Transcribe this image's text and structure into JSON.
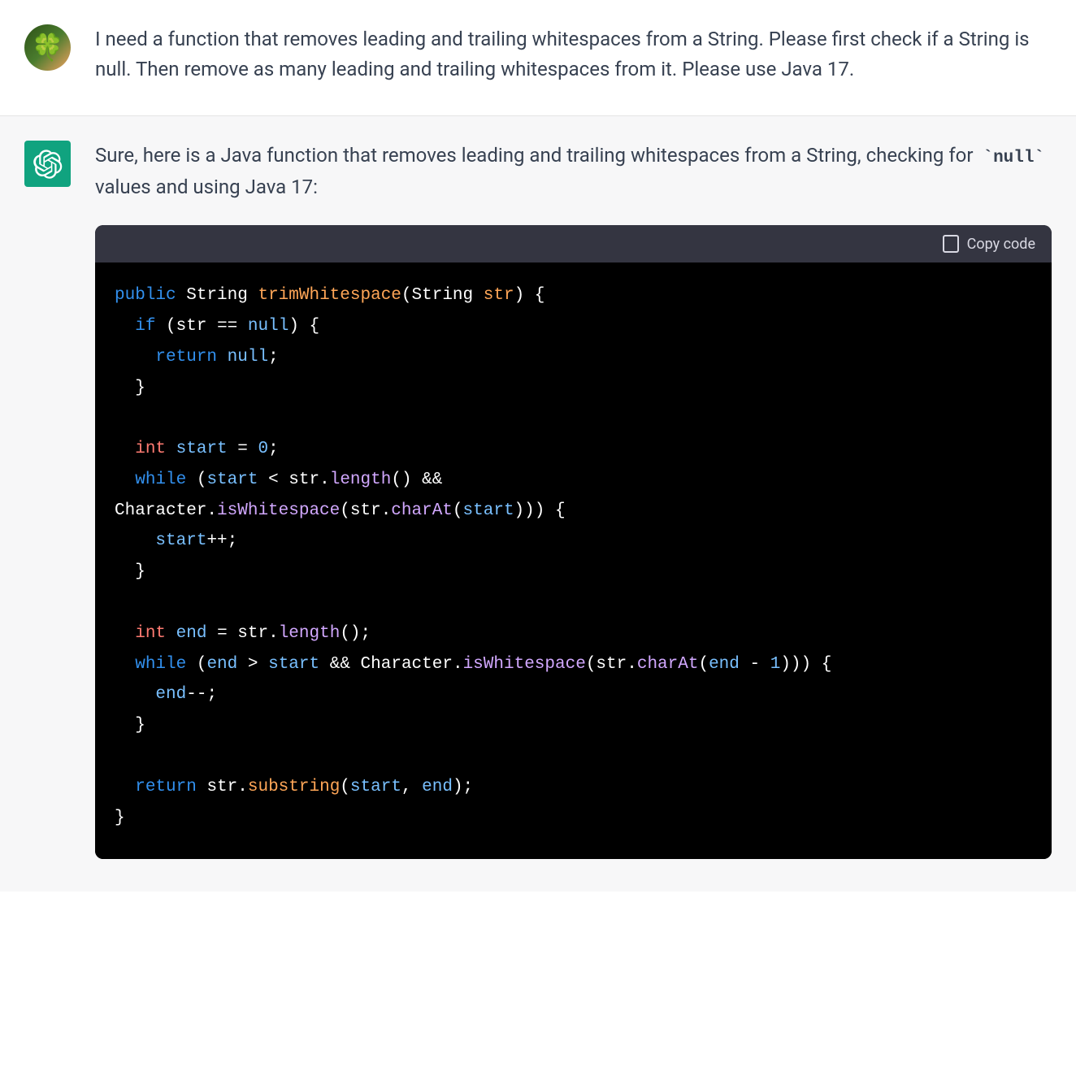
{
  "user_message": {
    "text": "I need a function that removes leading and trailing whitespaces from a String. Please first check if a String is null. Then remove as many leading and trailing whitespaces from it. Please use Java 17."
  },
  "assistant_message": {
    "intro_prefix": "Sure, here is a Java function that removes leading and trailing whitespaces from a String, checking for ",
    "inline_code": "`null`",
    "intro_suffix": " values and using Java 17:"
  },
  "code_block": {
    "copy_label": "Copy code",
    "tokens": {
      "public": "public",
      "String": "String",
      "funcname": "trimWhitespace",
      "str_param": "str",
      "if": "if",
      "str_var": "str",
      "eqeq": "==",
      "null": "null",
      "return": "return",
      "int": "int",
      "start": "start",
      "eq": "=",
      "zero": "0",
      "while": "while",
      "length": "length",
      "lt": "<",
      "amp": "&&",
      "Character": "Character",
      "isWhitespace": "isWhitespace",
      "charAt": "charAt",
      "plusplus": "++",
      "end": "end",
      "gt": ">",
      "minus": "-",
      "one": "1",
      "minusminus": "--",
      "substring": "substring"
    }
  }
}
